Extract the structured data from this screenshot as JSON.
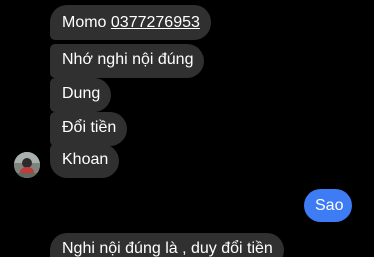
{
  "messages": {
    "m1_prefix": "Momo ",
    "m1_phone": "0377276953",
    "m2": "Nhớ nghi nội đúng",
    "m3": "Dung",
    "m4": "Đổi tiền",
    "m5": "Khoan",
    "sent": "Sao",
    "m6": "Nghi nội đúng là , duy đổi tiền"
  },
  "colors": {
    "background": "#000000",
    "incoming_bubble": "#303030",
    "outgoing_bubble": "#3d7cf5",
    "text": "#ffffff"
  }
}
